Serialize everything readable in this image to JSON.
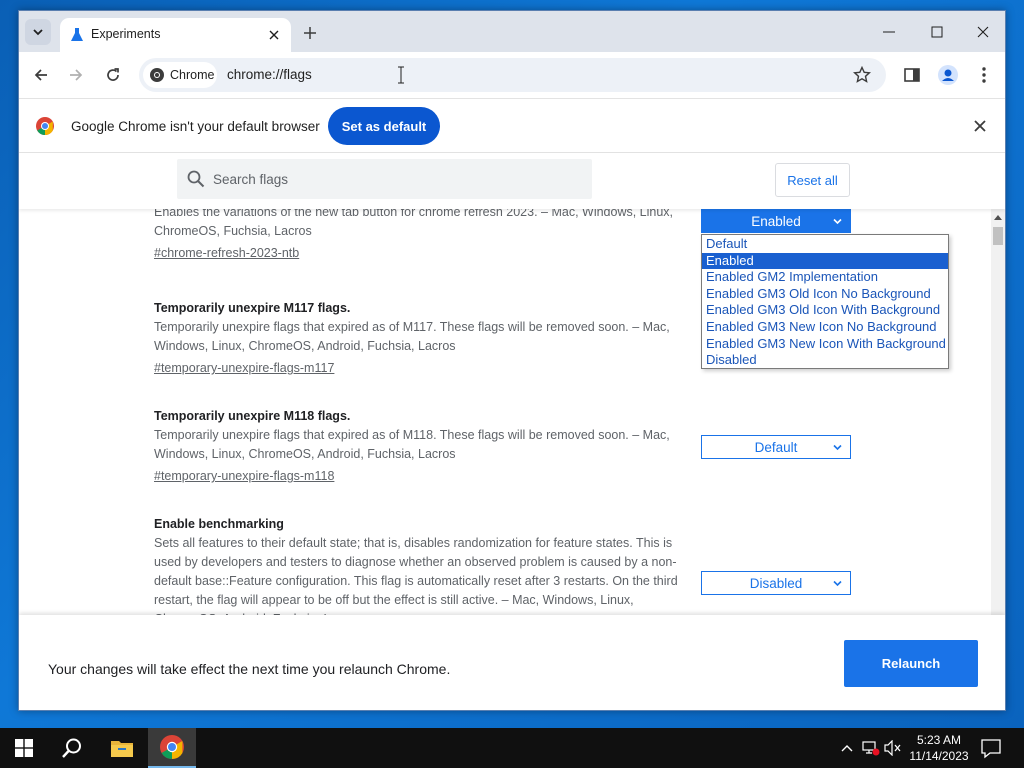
{
  "tab": {
    "title": "Experiments"
  },
  "omnibox": {
    "site_chip": "Chrome",
    "url": "chrome://flags"
  },
  "infobar": {
    "message": "Google Chrome isn't your default browser",
    "button": "Set as default"
  },
  "flags_header": {
    "search_placeholder": "Search flags",
    "reset_all": "Reset all"
  },
  "flags": [
    {
      "title": "",
      "description": "Enables the variations of the new tab button for chrome refresh 2023. – Mac, Windows, Linux, ChromeOS, Fuchsia, Lacros",
      "link": "#chrome-refresh-2023-ntb",
      "value": "Enabled"
    },
    {
      "title": "Temporarily unexpire M117 flags.",
      "description": "Temporarily unexpire flags that expired as of M117. These flags will be removed soon. – Mac, Windows, Linux, ChromeOS, Android, Fuchsia, Lacros",
      "link": "#temporary-unexpire-flags-m117",
      "value": ""
    },
    {
      "title": "Temporarily unexpire M118 flags.",
      "description": "Temporarily unexpire flags that expired as of M118. These flags will be removed soon. – Mac, Windows, Linux, ChromeOS, Android, Fuchsia, Lacros",
      "link": "#temporary-unexpire-flags-m118",
      "value": "Default"
    },
    {
      "title": "Enable benchmarking",
      "description": "Sets all features to their default state; that is, disables randomization for feature states. This is used by developers and testers to diagnose whether an observed problem is caused by a non-default base::Feature configuration. This flag is automatically reset after 3 restarts. On the third restart, the flag will appear to be off but the effect is still active. – Mac, Windows, Linux, ChromeOS, Android, Fuchsia, Lacros",
      "link": "",
      "value": "Disabled"
    }
  ],
  "dropdown": {
    "options": [
      "Default",
      "Enabled",
      "Enabled GM2 Implementation",
      "Enabled GM3 Old Icon No Background",
      "Enabled GM3 Old Icon With Background",
      "Enabled GM3 New Icon No Background",
      "Enabled GM3 New Icon With Background",
      "Disabled"
    ],
    "selected": "Enabled"
  },
  "footer": {
    "message": "Your changes will take effect the next time you relaunch Chrome.",
    "button": "Relaunch"
  },
  "taskbar": {
    "time": "5:23 AM",
    "date": "11/14/2023"
  },
  "colors": {
    "accent": "#1a73e8",
    "set_default": "#0b57d0",
    "taskbar": "#101010"
  },
  "icons": [
    "tab-search-icon",
    "flask-icon",
    "close-icon",
    "plus-icon",
    "minimize-icon",
    "maximize-icon",
    "back-icon",
    "forward-icon",
    "reload-icon",
    "chrome-icon",
    "star-icon",
    "side-panel-icon",
    "profile-icon",
    "kebab-menu-icon",
    "search-icon",
    "chevron-down-icon",
    "windows-start-icon",
    "taskbar-search-icon",
    "file-explorer-icon",
    "chrome-taskbar-icon",
    "chevron-up-icon",
    "network-icon",
    "volume-muted-icon",
    "notification-icon"
  ]
}
